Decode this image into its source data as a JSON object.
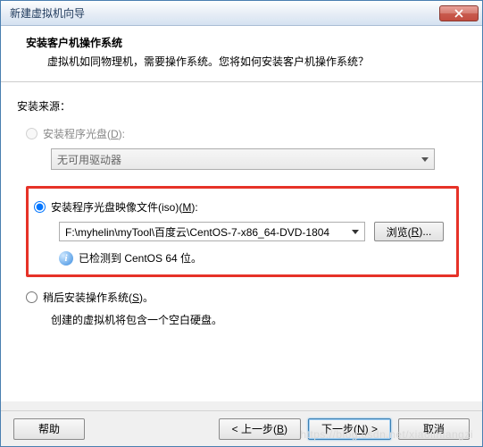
{
  "window": {
    "title": "新建虚拟机向导"
  },
  "header": {
    "title": "安装客户机操作系统",
    "subtitle": "虚拟机如同物理机，需要操作系统。您将如何安装客户机操作系统？"
  },
  "source": {
    "label": "安装来源：",
    "disc": {
      "label": "安装程序光盘(",
      "hotkey": "D",
      "suffix": "):",
      "drive": "无可用驱动器"
    },
    "iso": {
      "label": "安装程序光盘映像文件(iso)(",
      "hotkey": "M",
      "suffix": "):",
      "path": "F:\\myhelin\\myTool\\百度云\\CentOS-7-x86_64-DVD-1804",
      "browse": "浏览(",
      "browse_hotkey": "R",
      "browse_suffix": ")...",
      "detected": "已检测到 CentOS 64 位。"
    },
    "later": {
      "label": "稍后安装操作系统(",
      "hotkey": "S",
      "suffix": ")。",
      "note": "创建的虚拟机将包含一个空白硬盘。"
    }
  },
  "footer": {
    "help": "帮助",
    "back": "< 上一步(",
    "back_hotkey": "B",
    "back_suffix": ")",
    "next": "下一步(",
    "next_hotkey": "N",
    "next_suffix": ") >",
    "cancel": "取消"
  },
  "watermark": "https://blog.csdn.net/xiaolinlangzi"
}
